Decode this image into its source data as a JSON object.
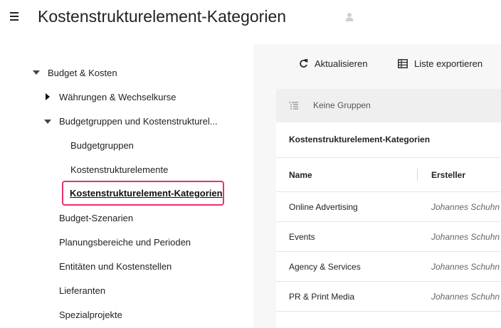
{
  "header": {
    "title": "Kostenstrukturelement-Kategorien"
  },
  "sidebar": {
    "items": [
      {
        "label": "Budget & Kosten"
      },
      {
        "label": "Währungen & Wechselkurse"
      },
      {
        "label": "Budgetgruppen und Kostenstrukturel..."
      },
      {
        "label": "Budgetgruppen"
      },
      {
        "label": "Kostenstrukturelemente"
      },
      {
        "label": "Kostenstrukturelement-Kategorien"
      },
      {
        "label": "Budget-Szenarien"
      },
      {
        "label": "Planungsbereiche und Perioden"
      },
      {
        "label": "Entitäten und Kostenstellen"
      },
      {
        "label": "Lieferanten"
      },
      {
        "label": "Spezialprojekte"
      }
    ]
  },
  "toolbar": {
    "refresh_label": "Aktualisieren",
    "export_label": "Liste exportieren"
  },
  "grouping": {
    "label": "Keine Gruppen"
  },
  "table": {
    "title": "Kostenstrukturelement-Kategorien",
    "columns": [
      "Name",
      "Ersteller"
    ],
    "rows": [
      {
        "name": "Online Advertising",
        "creator": "Johannes Schuhn"
      },
      {
        "name": "Events",
        "creator": "Johannes Schuhn"
      },
      {
        "name": "Agency & Services",
        "creator": "Johannes Schuhn"
      },
      {
        "name": "PR & Print Media",
        "creator": "Johannes Schuhn"
      }
    ]
  },
  "colors": {
    "active_outline": "#e8336a",
    "main_background": "#f7f7f7",
    "groupbar_background": "#efefef"
  }
}
